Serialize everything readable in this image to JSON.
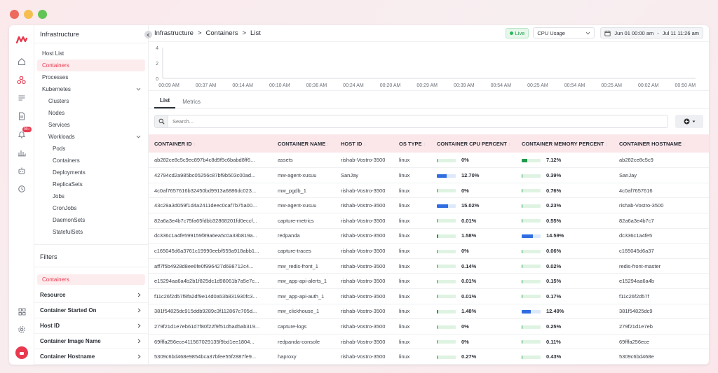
{
  "colors": {
    "accent": "#e8394f",
    "live_green": "#2ab95a",
    "cpu_bar_green": "#1f9a4b",
    "cpu_bar_blue": "#2f6de1",
    "traffic_red": "#ed6a5e",
    "traffic_yellow": "#f4bf4f",
    "traffic_green": "#61c554"
  },
  "rail": {
    "icons": [
      "logo-icon",
      "home-icon",
      "infrastructure-icon",
      "logs-icon",
      "document-icon",
      "alerts-icon",
      "dashboard-icon",
      "bot-icon",
      "integrations-icon"
    ],
    "alert_badge": "99+",
    "bottom_icons": [
      "grid-icon",
      "settings-icon"
    ]
  },
  "sidebar": {
    "title": "Infrastructure",
    "items": [
      {
        "label": "Host List",
        "level": 0
      },
      {
        "label": "Containers",
        "level": 0,
        "active": true
      },
      {
        "label": "Processes",
        "level": 0
      },
      {
        "label": "Kubernetes",
        "level": 0,
        "expandable": true
      },
      {
        "label": "Clusters",
        "level": 1
      },
      {
        "label": "Nodes",
        "level": 1
      },
      {
        "label": "Services",
        "level": 1
      },
      {
        "label": "Workloads",
        "level": 1,
        "expandable": true
      },
      {
        "label": "Pods",
        "level": 2
      },
      {
        "label": "Containers",
        "level": 2
      },
      {
        "label": "Deployments",
        "level": 2
      },
      {
        "label": "ReplicaSets",
        "level": 2
      },
      {
        "label": "Jobs",
        "level": 2
      },
      {
        "label": "CronJobs",
        "level": 2
      },
      {
        "label": "DaemonSets",
        "level": 2
      },
      {
        "label": "StatefulSets",
        "level": 2
      }
    ],
    "filters_title": "Filters",
    "active_filter": "Containers",
    "filters": [
      "Resource",
      "Container Started On",
      "Host ID",
      "Container Image Name",
      "Container Hostname"
    ]
  },
  "header": {
    "breadcrumb": [
      "Infrastructure",
      ">",
      "Containers",
      ">",
      "List"
    ],
    "live_label": "Live",
    "metric_select": "CPU Usage",
    "date_from": "Jun 01 00:00 am",
    "date_sep": "-",
    "date_to": "Jul 11 11:26 am"
  },
  "chart_data": {
    "type": "line",
    "y_ticks": [
      "4",
      "2",
      "0"
    ],
    "ylim": [
      0,
      4
    ],
    "x_ticks": [
      "00:09 AM",
      "00:37 AM",
      "00:14 AM",
      "00:10 AM",
      "00:36 AM",
      "00:24 AM",
      "00:20 AM",
      "00:29 AM",
      "00:39 AM",
      "00:54 AM",
      "00:25 AM",
      "00:54 AM",
      "00:25 AM",
      "00:02 AM",
      "00:50 AM"
    ],
    "series": []
  },
  "tabs": [
    "List",
    "Metrics"
  ],
  "search": {
    "placeholder": "Search..."
  },
  "table": {
    "columns": [
      "CONTAINER ID",
      "CONTAINER NAME",
      "HOST ID",
      "OS TYPE",
      "CONTAINER CPU PERCENT",
      "CONTAINER MEMORY PERCENT",
      "CONTAINER HOSTNAME"
    ],
    "rows": [
      {
        "id": "ab282ce8c5c9ec897b4c8d9f5c6babd8ff6...",
        "name": "assets",
        "host": "rishab-Vostro-3500",
        "os": "linux",
        "cpu": 0,
        "cpu_label": "0%",
        "mem": 7.12,
        "mem_label": "7.12%",
        "hostname": "ab282ce8c5c9"
      },
      {
        "id": "42794cd2a985bc05256c87bf9b503c00ad...",
        "name": "mw-agent-xusuu",
        "host": "SanJay",
        "os": "linux",
        "cpu": 12.7,
        "cpu_label": "12.70%",
        "mem": 0.39,
        "mem_label": "0.39%",
        "hostname": "SanJay"
      },
      {
        "id": "4c0af7657616b32450bd9913a6886dc023...",
        "name": "mw_pgdb_1",
        "host": "rishab-Vostro-3500",
        "os": "linux",
        "cpu": 0,
        "cpu_label": "0%",
        "mem": 0.76,
        "mem_label": "0.76%",
        "hostname": "4c0af7657616"
      },
      {
        "id": "43c29a3d059f1d4a2411deec0caf7b75a00...",
        "name": "mw-agent-xusuu",
        "host": "rishab-Vostro-3500",
        "os": "linux",
        "cpu": 15.02,
        "cpu_label": "15.02%",
        "mem": 0.23,
        "mem_label": "0.23%",
        "hostname": "rishab-Vostro-3500"
      },
      {
        "id": "82a6a3e4b7c75fa65fdbb32868201fd0eccf...",
        "name": "capture-metrics",
        "host": "rishab-Vostro-3500",
        "os": "linux",
        "cpu": 0.01,
        "cpu_label": "0.01%",
        "mem": 0.55,
        "mem_label": "0.55%",
        "hostname": "82a6a3e4b7c7"
      },
      {
        "id": "dc336c1a4fe599159f89a6ea5c0a33b819a...",
        "name": "redpanda",
        "host": "rishab-Vostro-3500",
        "os": "linux",
        "cpu": 1.58,
        "cpu_label": "1.58%",
        "mem": 14.59,
        "mem_label": "14.59%",
        "hostname": "dc336c1a4fe5"
      },
      {
        "id": "c165045d6a3761c19990eebf559a918abb1...",
        "name": "capture-traces",
        "host": "rishab-Vostro-3500",
        "os": "linux",
        "cpu": 0,
        "cpu_label": "0%",
        "mem": 0.06,
        "mem_label": "0.06%",
        "hostname": "c165045d6a37"
      },
      {
        "id": "aff7f5b4928d8ee6fe0f996427d698712c4...",
        "name": "mw_redis-front_1",
        "host": "rishab-Vostro-3500",
        "os": "linux",
        "cpu": 0.14,
        "cpu_label": "0.14%",
        "mem": 0.02,
        "mem_label": "0.02%",
        "hostname": "redis-front-master"
      },
      {
        "id": "e15294aa6a4b2b1f825dc1d98061b7a5e7c...",
        "name": "mw_app-api-alerts_1",
        "host": "rishab-Vostro-3500",
        "os": "linux",
        "cpu": 0.01,
        "cpu_label": "0.01%",
        "mem": 0.15,
        "mem_label": "0.15%",
        "hostname": "e15294aa6a4b"
      },
      {
        "id": "f11c26f2d57f8fa2df9e14d0a53b831930fc3...",
        "name": "mw_app-api-auth_1",
        "host": "rishab-Vostro-3500",
        "os": "linux",
        "cpu": 0.01,
        "cpu_label": "0.01%",
        "mem": 0.17,
        "mem_label": "0.17%",
        "hostname": "f11c26f2d57f"
      },
      {
        "id": "381f54825dc915ddb9289c3f112867c705d...",
        "name": "mw_clickhouse_1",
        "host": "rishab-Vostro-3500",
        "os": "linux",
        "cpu": 1.48,
        "cpu_label": "1.48%",
        "mem": 12.49,
        "mem_label": "12.49%",
        "hostname": "381f54825dc9"
      },
      {
        "id": "279f21d1e7eb61d7f80f22f9f51d5ad5ab319...",
        "name": "capture-logs",
        "host": "rishab-Vostro-3500",
        "os": "linux",
        "cpu": 0,
        "cpu_label": "0%",
        "mem": 0.25,
        "mem_label": "0.25%",
        "hostname": "279f21d1e7eb"
      },
      {
        "id": "69fffa256ece411567029135f9bd1ee1804...",
        "name": "redpanda-console",
        "host": "rishab-Vostro-3500",
        "os": "linux",
        "cpu": 0,
        "cpu_label": "0%",
        "mem": 0.11,
        "mem_label": "0.11%",
        "hostname": "69fffa256ece"
      },
      {
        "id": "5309c6bd468e9854bca37bfee55f2887fe9...",
        "name": "haproxy",
        "host": "rishab-Vostro-3500",
        "os": "linux",
        "cpu": 0.27,
        "cpu_label": "0.27%",
        "mem": 0.43,
        "mem_label": "0.43%",
        "hostname": "5309c6bd468e"
      }
    ]
  }
}
